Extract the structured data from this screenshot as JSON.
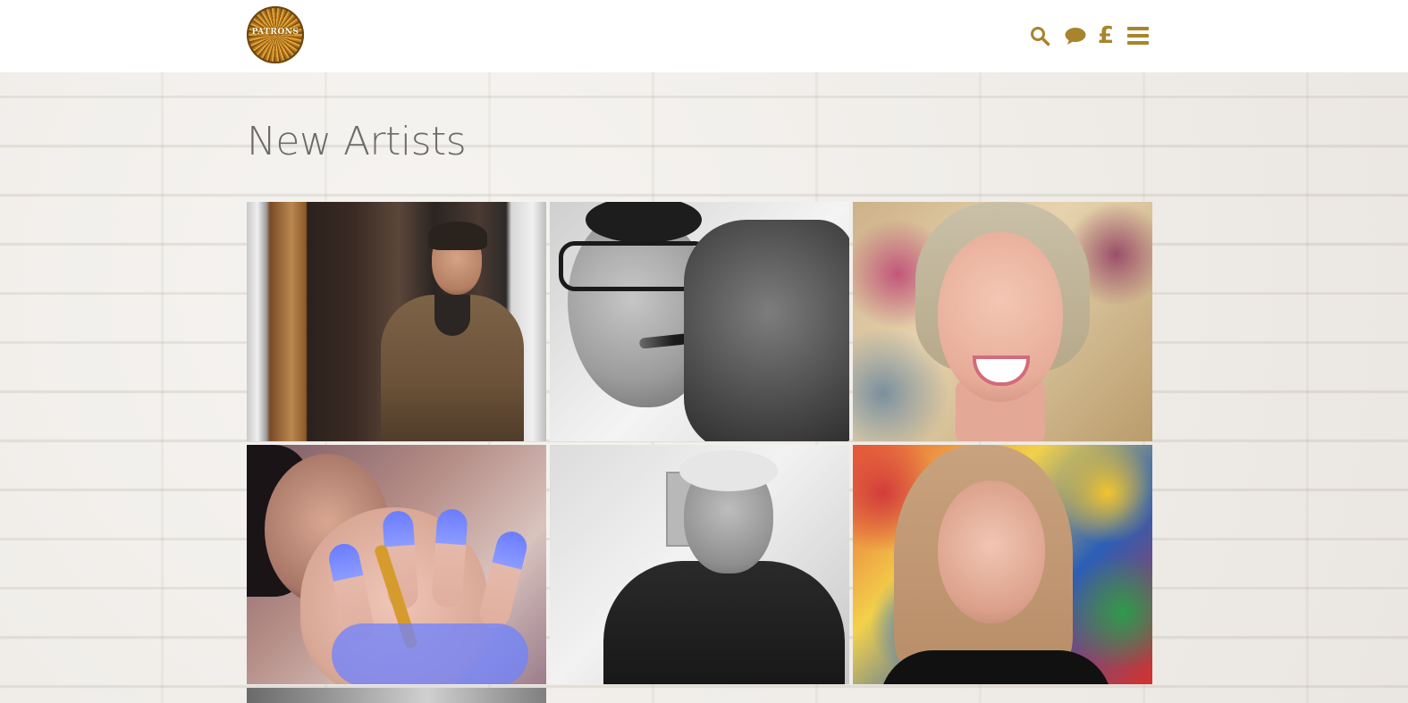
{
  "header": {
    "logo_text": "PATRONS",
    "icons": {
      "search": "search-icon",
      "chat": "chat-icon",
      "currency": "pound-icon",
      "menu": "hamburger-menu-icon"
    },
    "currency_symbol": "£",
    "accent_color": "#a8842c"
  },
  "main": {
    "title": "New Artists"
  },
  "artists": [
    {
      "photo": "artist-photo"
    },
    {
      "photo": "artist-photo"
    },
    {
      "photo": "artist-photo"
    },
    {
      "photo": "artist-photo"
    },
    {
      "photo": "artist-photo"
    },
    {
      "photo": "artist-photo"
    },
    {
      "photo": "artist-photo"
    }
  ]
}
